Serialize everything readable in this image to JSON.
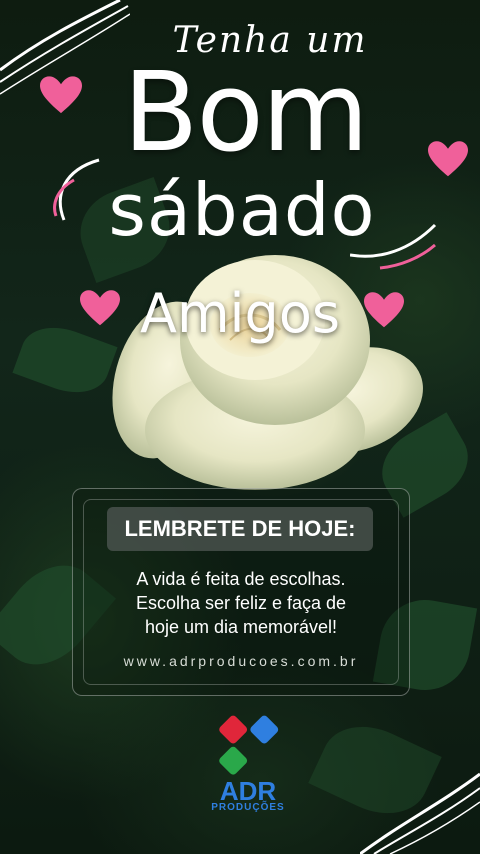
{
  "greeting": {
    "line1": "Tenha um",
    "line2": "Bom",
    "line3": "sábado",
    "line4": "Amigos"
  },
  "reminder": {
    "title": "LEMBRETE DE HOJE:",
    "lines": [
      "A vida é feita de escolhas.",
      "Escolha ser feliz e faça de",
      "hoje um dia memorável!"
    ],
    "url": "www.adrproducoes.com.br"
  },
  "brand": {
    "name": "ADR",
    "subtitle": "PRODUÇÕES"
  },
  "colors": {
    "heart": "#f0609a",
    "brand_blue": "#2f7fe0",
    "brand_red": "#e0263a",
    "brand_green": "#2aa84a",
    "text": "#ffffff"
  }
}
